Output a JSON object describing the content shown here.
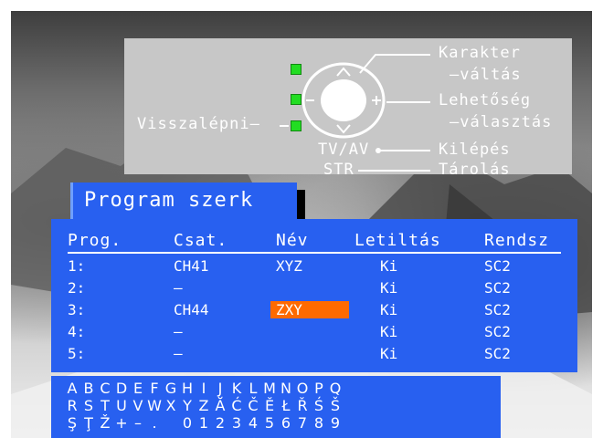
{
  "help": {
    "back_label": "Visszalépni–",
    "karakter_line1": "Karakter",
    "karakter_line2": "–váltás",
    "lehetoseg_line1": "Lehetőség",
    "lehetoseg_line2": "–választás",
    "tvav_label": "TV/AV",
    "kilepes_label": "Kilépés",
    "str_label": "STR",
    "tarolas_label": "Tárolás",
    "remote_symbols": {
      "up": "^",
      "down": "v",
      "left": "–",
      "right": "+"
    }
  },
  "menu": {
    "title": "Program szerk"
  },
  "table": {
    "headers": {
      "prog": "Prog.",
      "csat": "Csat.",
      "nev": "Név",
      "letiltas": "Letiltás",
      "rendszer": "Rendsz"
    },
    "rows": [
      {
        "prog": "1:",
        "csat": "CH41",
        "nev": "XYZ",
        "letiltas": "Ki",
        "rendszer": "SC2"
      },
      {
        "prog": "2:",
        "csat": "–",
        "nev": "",
        "letiltas": "Ki",
        "rendszer": "SC2"
      },
      {
        "prog": "3:",
        "csat": "CH44",
        "nev": "ZXY",
        "letiltas": "Ki",
        "rendszer": "SC2"
      },
      {
        "prog": "4:",
        "csat": "–",
        "nev": "",
        "letiltas": "Ki",
        "rendszer": "SC2"
      },
      {
        "prog": "5:",
        "csat": "–",
        "nev": "",
        "letiltas": "Ki",
        "rendszer": "SC2"
      }
    ],
    "active_row": 3
  },
  "chars": {
    "row1": [
      "A",
      "B",
      "C",
      "D",
      "E",
      "F",
      "G",
      "H",
      "I",
      "J",
      "K",
      "L",
      "M",
      "N",
      "O",
      "P",
      "Q"
    ],
    "row2": [
      "R",
      "S",
      "T",
      "U",
      "V",
      "W",
      "X",
      "Y",
      "Z",
      "Ă",
      "Ć",
      "Č",
      "Ě",
      "Ł",
      "Ř",
      "Ś",
      "Š"
    ],
    "row3": [
      "Ş",
      "Ţ",
      "Ž",
      "+",
      "–",
      ".",
      "",
      "0",
      "1",
      "2",
      "3",
      "4",
      "5",
      "6",
      "7",
      "8",
      "9"
    ]
  },
  "colors": {
    "menu_blue": "#2860f0",
    "highlight_orange": "#ff6a00",
    "led_green": "#22dd22",
    "panel_gray": "#c7c7c7"
  },
  "icons": {
    "remote_ring": "remote-direction-ring-icon",
    "indicator": "green-led-icon"
  }
}
